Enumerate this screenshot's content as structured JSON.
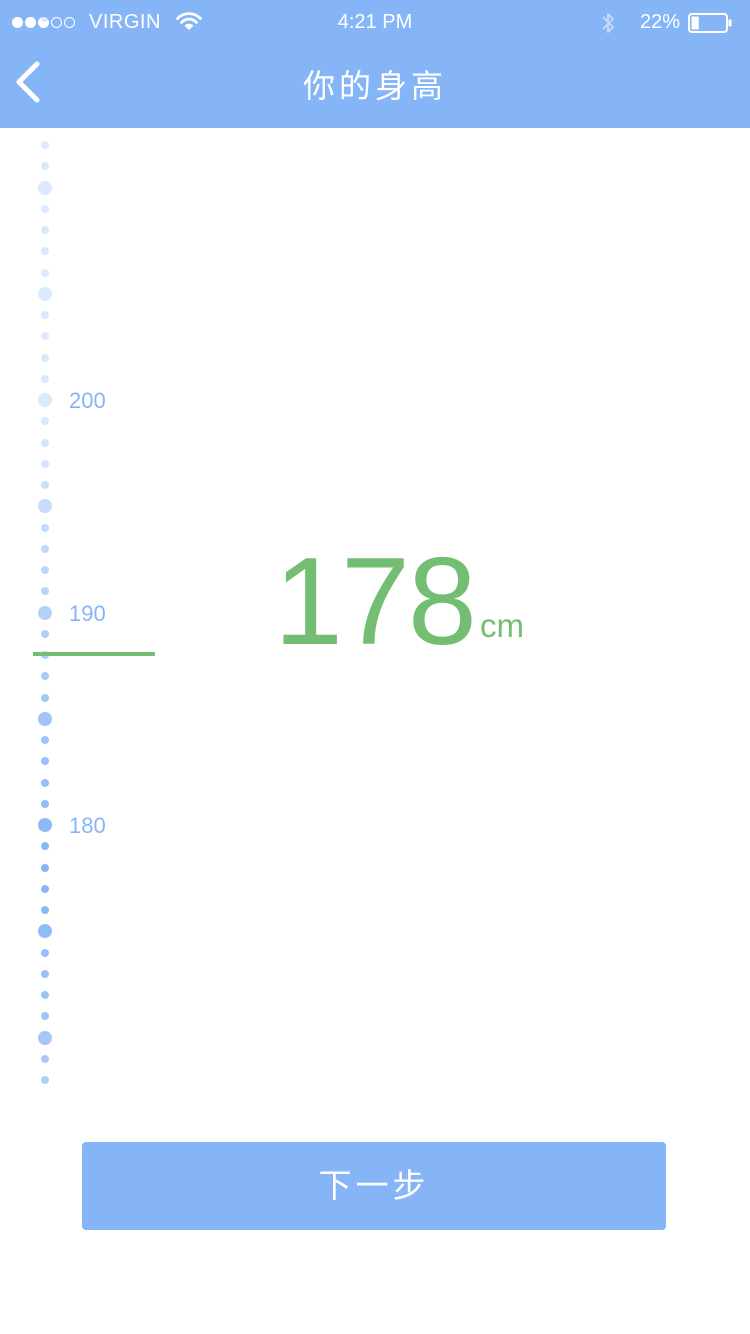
{
  "status_bar": {
    "signal_bars_filled": 3,
    "signal_bars_total": 5,
    "carrier": "VIRGIN",
    "wifi_icon": "wifi-icon",
    "time": "4:21 PM",
    "bluetooth_icon": "bluetooth-icon",
    "battery_percent": "22%",
    "battery_level": 0.22
  },
  "nav": {
    "back_icon": "chevron-left-icon",
    "title": "你的身高"
  },
  "ruler": {
    "labels": [
      "200",
      "190",
      "180"
    ],
    "selected_value": 178
  },
  "display": {
    "value": "178",
    "unit": "cm"
  },
  "next_button": {
    "label": "下一步"
  },
  "colors": {
    "header": "#86b5f7",
    "accent_green": "#74be74",
    "ruler_dot": "#86b5f7",
    "button": "#86b5f7"
  }
}
